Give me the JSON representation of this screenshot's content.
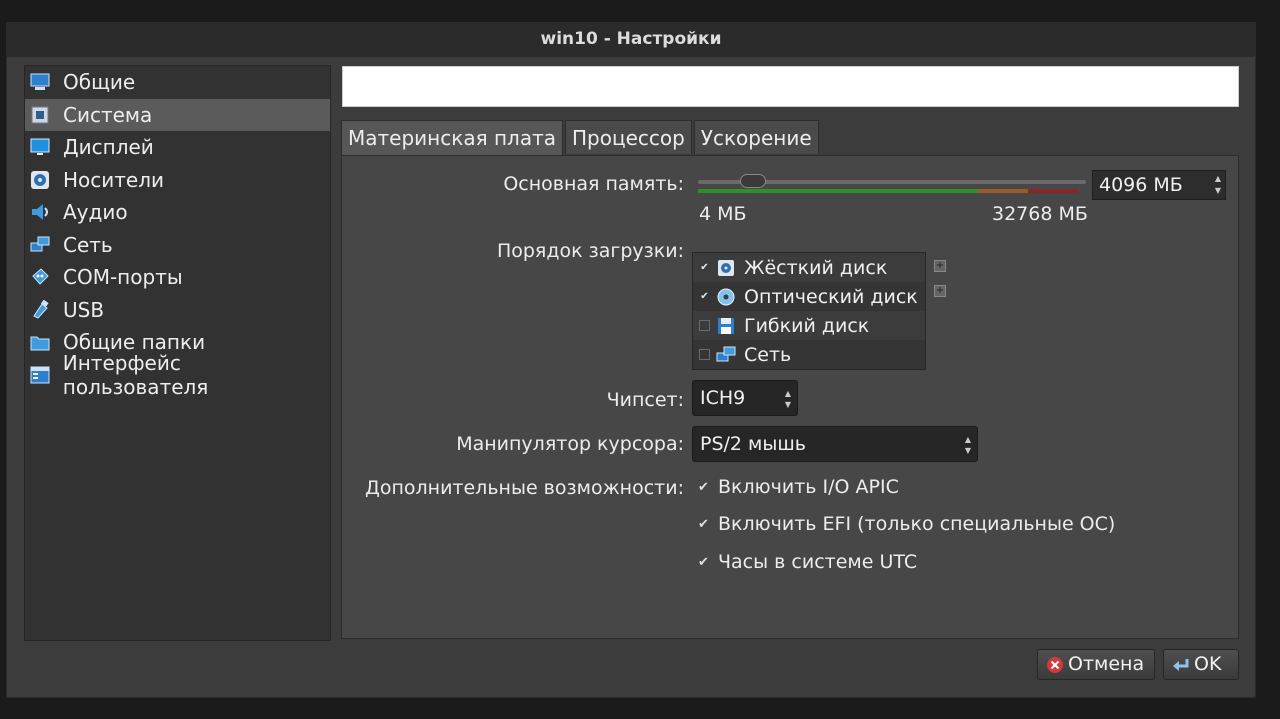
{
  "window": {
    "title": "win10 - Настройки"
  },
  "sidebar": {
    "items": [
      {
        "label": "Общие",
        "icon": "display-icon",
        "selected": false
      },
      {
        "label": "Система",
        "icon": "chip-icon",
        "selected": true
      },
      {
        "label": "Дисплей",
        "icon": "monitor-icon",
        "selected": false
      },
      {
        "label": "Носители",
        "icon": "storage-icon",
        "selected": false
      },
      {
        "label": "Аудио",
        "icon": "speaker-icon",
        "selected": false
      },
      {
        "label": "Сеть",
        "icon": "network-icon",
        "selected": false
      },
      {
        "label": "COM-порты",
        "icon": "serial-port-icon",
        "selected": false
      },
      {
        "label": "USB",
        "icon": "usb-icon",
        "selected": false
      },
      {
        "label": "Общие папки",
        "icon": "folder-icon",
        "selected": false
      },
      {
        "label": "Интерфейс пользователя",
        "icon": "window-icon",
        "selected": false
      }
    ]
  },
  "tabs": [
    {
      "label": "Материнская плата",
      "active": true
    },
    {
      "label": "Процессор",
      "active": false
    },
    {
      "label": "Ускорение",
      "active": false
    }
  ],
  "motherboard": {
    "memory_label": "Основная память:",
    "memory_value": "4096 МБ",
    "memory_min": "4 МБ",
    "memory_max": "32768 МБ",
    "boot_order_label": "Порядок загрузки:",
    "boot_items": [
      {
        "label": "Жёсткий диск",
        "checked": true,
        "icon": "hard-disk-icon"
      },
      {
        "label": "Оптический диск",
        "checked": true,
        "icon": "optical-disc-icon"
      },
      {
        "label": "Гибкий диск",
        "checked": false,
        "icon": "floppy-disk-icon"
      },
      {
        "label": "Сеть",
        "checked": false,
        "icon": "network-icon"
      }
    ],
    "chipset_label": "Чипсет:",
    "chipset_value": "ICH9",
    "pointing_label": "Манипулятор курсора:",
    "pointing_value": "PS/2 мышь",
    "extended_label": "Дополнительные возможности:",
    "features": [
      {
        "label": "Включить I/O APIC",
        "checked": true
      },
      {
        "label": "Включить EFI (только специальные ОС)",
        "checked": true
      },
      {
        "label": "Часы в системе UTC",
        "checked": true
      }
    ]
  },
  "buttons": {
    "cancel": "Отмена",
    "ok": "OK"
  },
  "colors": {
    "accent_green": "#2f8f2f",
    "accent_red": "#8a2626",
    "selected_bg": "#5b5b5b"
  }
}
